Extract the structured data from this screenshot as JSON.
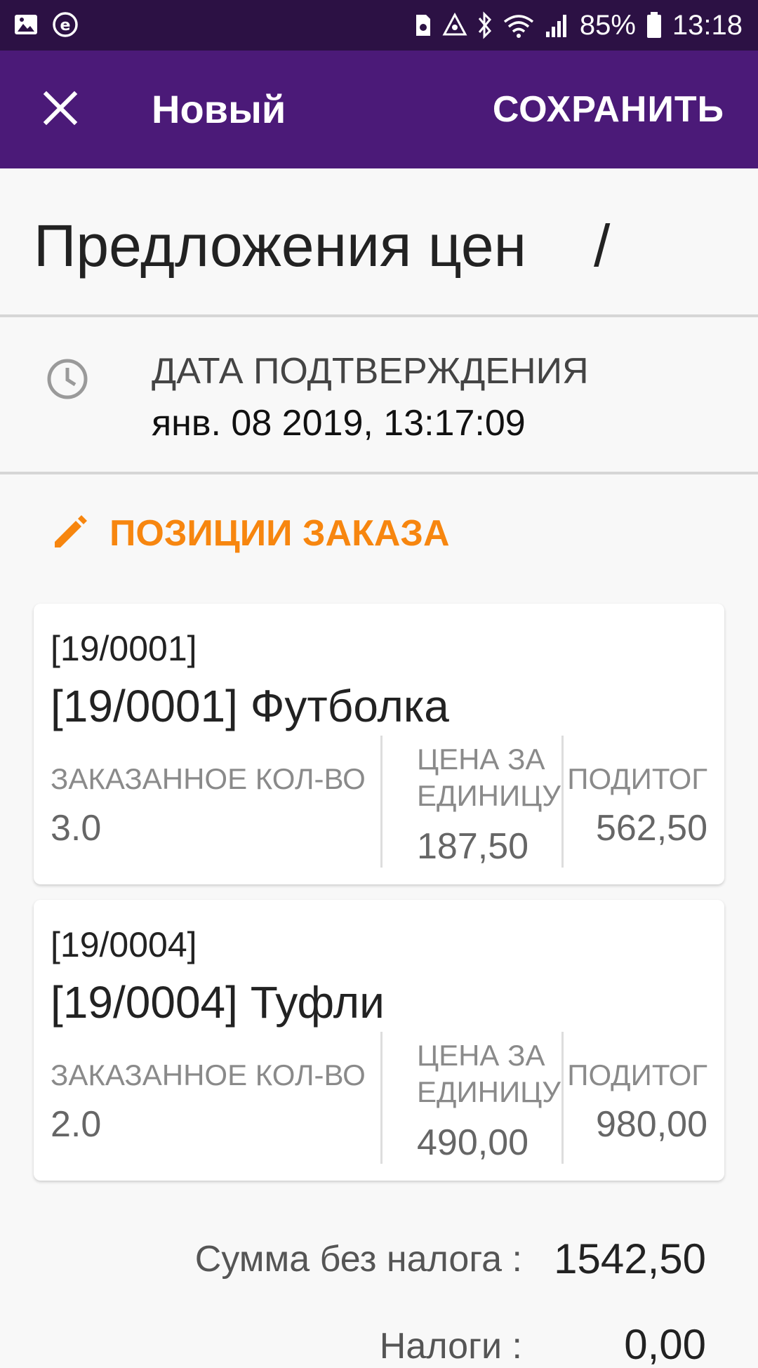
{
  "status_bar": {
    "battery_percent": "85%",
    "time": "13:18",
    "icons": [
      "gallery-icon",
      "e-app-icon",
      "sim-icon",
      "recycle-icon",
      "bluetooth-icon",
      "wifi-icon",
      "signal-icon",
      "battery-icon"
    ]
  },
  "app_bar": {
    "close_icon": "close-icon",
    "title": "Новый",
    "save_label": "СОХРАНИТЬ",
    "color": "#4b1a78"
  },
  "record": {
    "title": "Предложения цен",
    "separator": "/"
  },
  "confirmation": {
    "icon": "clock-icon",
    "label": "ДАТА ПОДТВЕРЖДЕНИЯ",
    "value": "янв. 08 2019, 13:17:09"
  },
  "order_lines": {
    "icon": "pencil-icon",
    "title": "ПОЗИЦИИ ЗАКАЗА",
    "accent": "#f7860f",
    "items": [
      {
        "code": "[19/0001]",
        "name": "[19/0001] Футболка",
        "qty_label": "ЗАКАЗАННОЕ КОЛ-ВО",
        "qty": "3.0",
        "price_label": "ЦЕНА ЗА ЕДИНИЦУ",
        "price": "187,50",
        "subtotal_label": "ПОДИТОГ",
        "subtotal": "562,50"
      },
      {
        "code": "[19/0004]",
        "name": "[19/0004] Туфли",
        "qty_label": "ЗАКАЗАННОЕ КОЛ-ВО",
        "qty": "2.0",
        "price_label": "ЦЕНА ЗА ЕДИНИЦУ",
        "price": "490,00",
        "subtotal_label": "ПОДИТОГ",
        "subtotal": "980,00"
      }
    ]
  },
  "totals": {
    "untaxed_label": "Сумма без налога :",
    "untaxed_value": "1542,50",
    "taxes_label": "Налоги :",
    "taxes_value": "0,00"
  }
}
